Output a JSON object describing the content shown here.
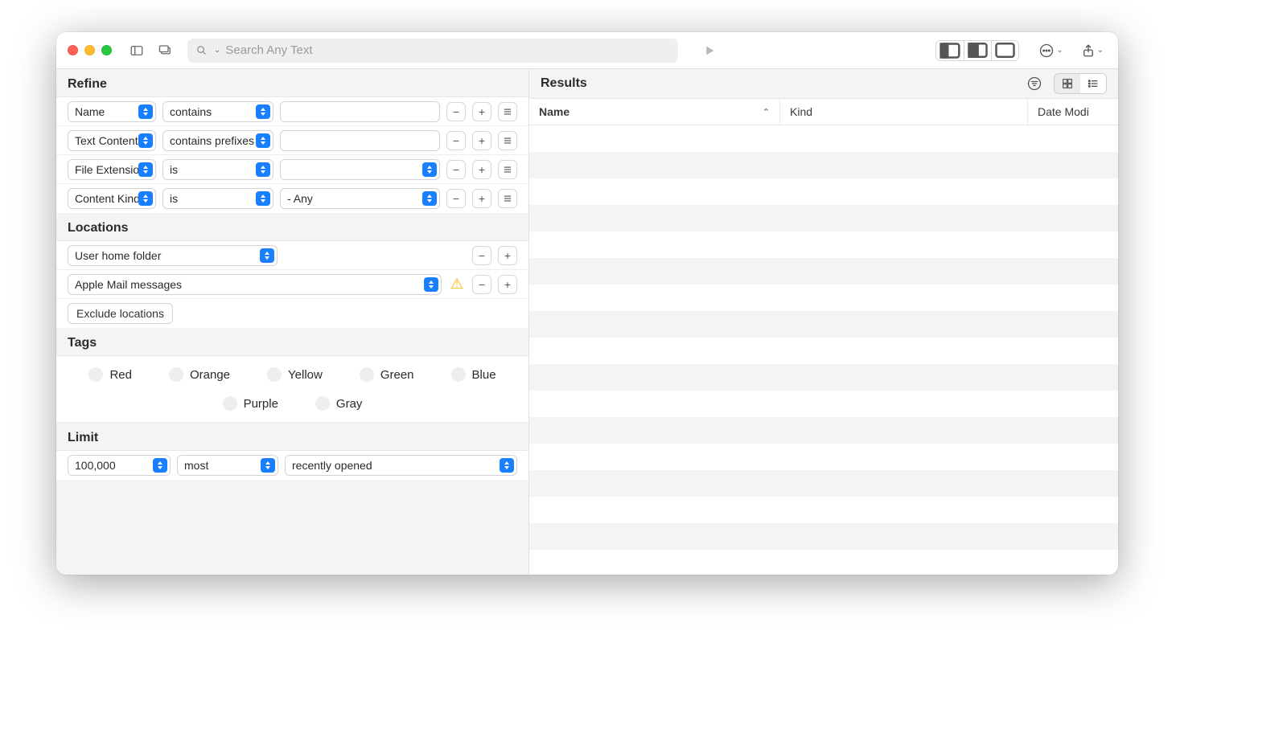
{
  "toolbar": {
    "search_placeholder": "Search Any Text"
  },
  "refine": {
    "title": "Refine",
    "rows": [
      {
        "attr": "Name",
        "op": "contains",
        "value": "",
        "value_is_popup": false
      },
      {
        "attr": "Text Content",
        "op": "contains prefixes",
        "value": "",
        "value_is_popup": false
      },
      {
        "attr": "File Extension",
        "op": "is",
        "value": "",
        "value_is_popup": true
      },
      {
        "attr": "Content Kind",
        "op": "is",
        "value": "- Any",
        "value_is_popup": true
      }
    ]
  },
  "locations": {
    "title": "Locations",
    "items": [
      {
        "label": "User home folder",
        "warning": false
      },
      {
        "label": "Apple Mail messages",
        "warning": true
      }
    ],
    "exclude_button": "Exclude locations"
  },
  "tags": {
    "title": "Tags",
    "items": [
      "Red",
      "Orange",
      "Yellow",
      "Green",
      "Blue",
      "Purple",
      "Gray"
    ]
  },
  "limit": {
    "title": "Limit",
    "count": "100,000",
    "order": "most",
    "by": "recently opened"
  },
  "results": {
    "title": "Results",
    "columns": {
      "name": "Name",
      "kind": "Kind",
      "date": "Date Modi"
    }
  }
}
